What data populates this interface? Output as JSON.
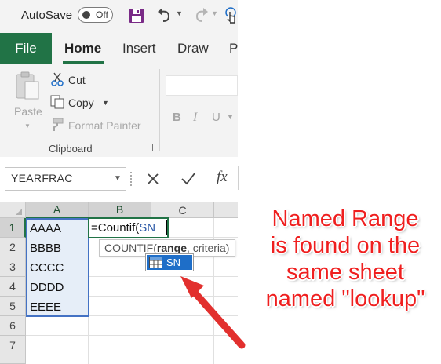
{
  "titlebar": {
    "autosave_label": "AutoSave",
    "autosave_state": "Off"
  },
  "tabs": {
    "file": "File",
    "home": "Home",
    "insert": "Insert",
    "draw": "Draw",
    "partial": "P"
  },
  "ribbon": {
    "paste": "Paste",
    "cut": "Cut",
    "copy": "Copy",
    "format_painter": "Format Painter",
    "group_label": "Clipboard",
    "bold": "B",
    "italic": "I",
    "underline": "U"
  },
  "formula_bar": {
    "name_box": "YEARFRAC",
    "fx": "fx"
  },
  "grid": {
    "columns": [
      "A",
      "B",
      "C"
    ],
    "rows": [
      "1",
      "2",
      "3",
      "4",
      "5",
      "6",
      "7"
    ],
    "column_a": [
      "AAAA",
      "BBBB",
      "CCCC",
      "DDDD",
      "EEEE"
    ],
    "b1_prefix": "=Countif(",
    "b1_arg": "SN"
  },
  "tooltip": {
    "func": "COUNTIF(",
    "arg_bold": "range",
    "rest": ", criteria)"
  },
  "autocomplete": {
    "item": "SN"
  },
  "annotation": {
    "lines": [
      "Named Range",
      "is found on the",
      "same sheet",
      "named \"lookup\""
    ]
  },
  "colors": {
    "excel_green": "#217346",
    "annotation_red": "#ef1f1f",
    "selection_blue": "#1e6ec8"
  }
}
